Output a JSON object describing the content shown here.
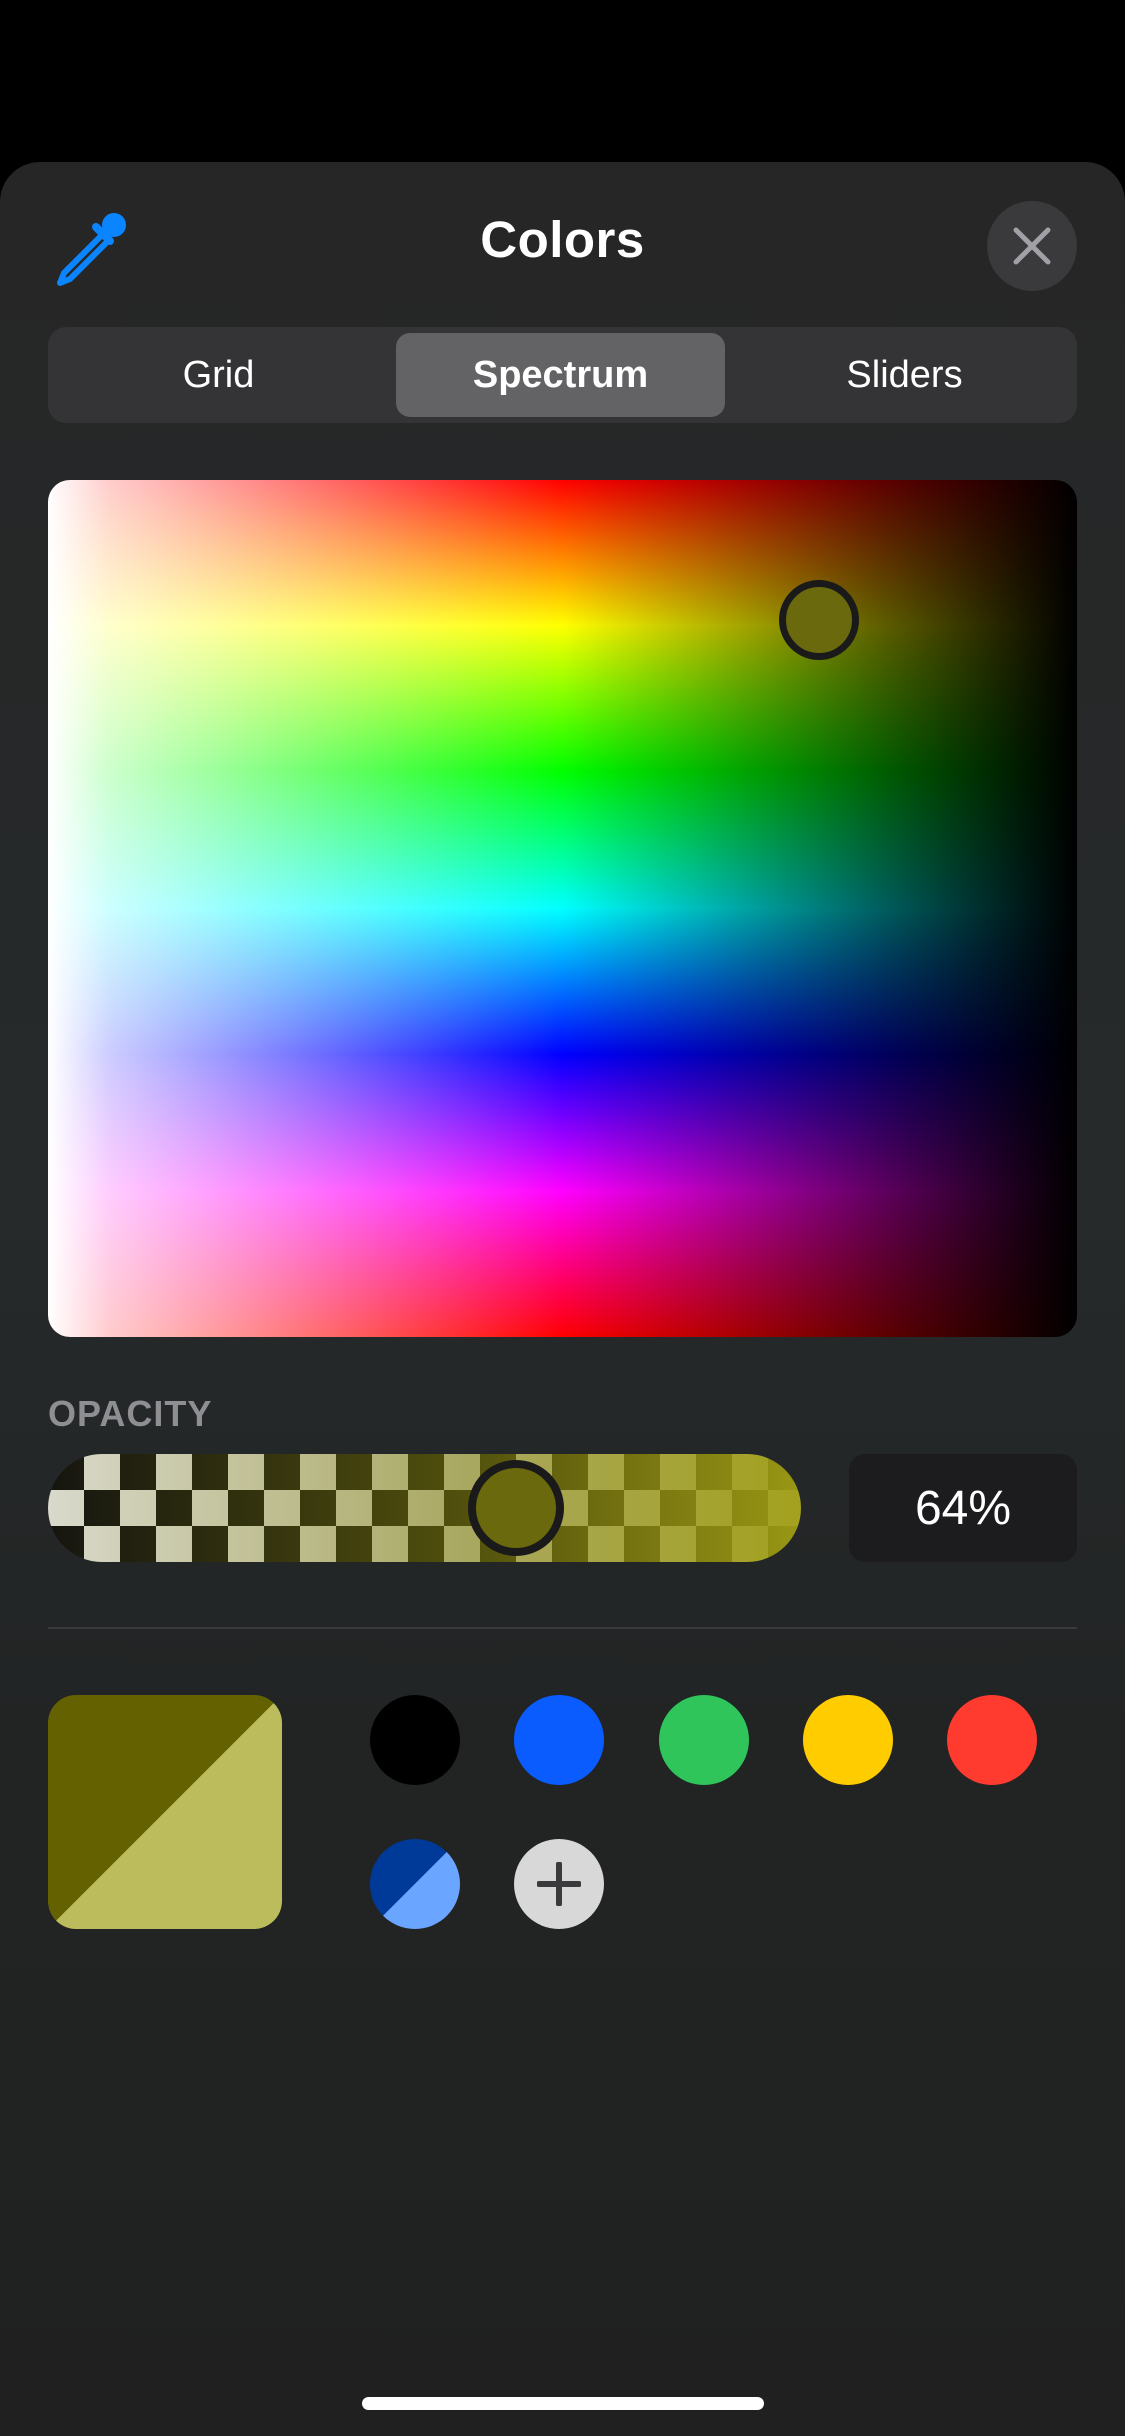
{
  "header": {
    "title": "Colors",
    "eyedropper_icon": "eyedropper-icon",
    "close_icon": "close-icon"
  },
  "tabs": [
    {
      "label": "Grid",
      "active": false
    },
    {
      "label": "Spectrum",
      "active": true
    },
    {
      "label": "Sliders",
      "active": false
    }
  ],
  "opacity": {
    "label": "OPACITY",
    "value_text": "64%",
    "value": 0.64
  },
  "colors": {
    "accent": "#0a84ff",
    "selected_color": "#646200",
    "selected_color_with_opacity": "#bcbc5c",
    "swatches": [
      {
        "name": "black",
        "color": "#000000"
      },
      {
        "name": "blue",
        "color": "#0a5cff"
      },
      {
        "name": "green",
        "color": "#30c55a"
      },
      {
        "name": "yellow",
        "color": "#ffcc00"
      },
      {
        "name": "red",
        "color": "#ff3b30"
      },
      {
        "name": "dark-blue-light-blue",
        "color": "#003a99",
        "color2": "#6aa5ff"
      }
    ],
    "add_icon": "plus-icon"
  }
}
